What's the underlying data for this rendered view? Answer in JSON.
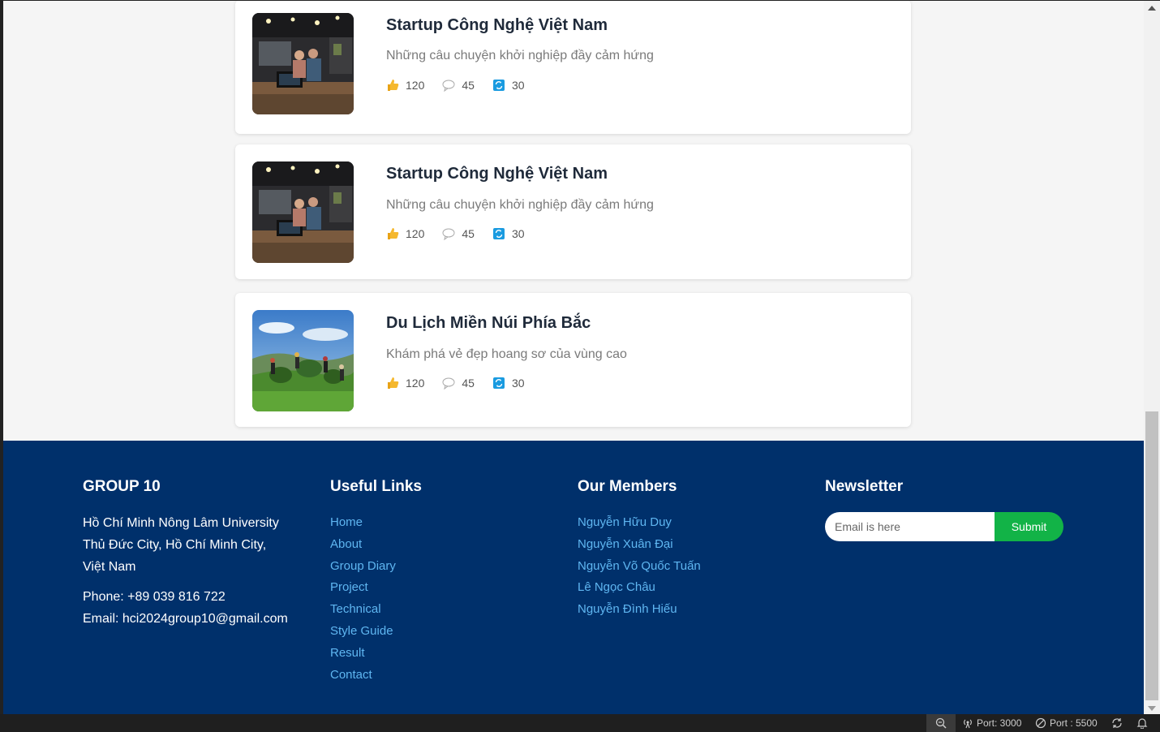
{
  "posts": [
    {
      "title": "Startup Công Nghệ Việt Nam",
      "desc": "Những câu chuyện khởi nghiệp đầy cảm hứng",
      "likes": "120",
      "comments": "45",
      "shares": "30",
      "image": "office-photo"
    },
    {
      "title": "Startup Công Nghệ Việt Nam",
      "desc": "Những câu chuyện khởi nghiệp đầy cảm hứng",
      "likes": "120",
      "comments": "45",
      "shares": "30",
      "image": "office-photo"
    },
    {
      "title": "Du Lịch Miền Núi Phía Bắc",
      "desc": "Khám phá vẻ đẹp hoang sơ của vùng cao",
      "likes": "120",
      "comments": "45",
      "shares": "30",
      "image": "tea-hill-photo"
    }
  ],
  "footer": {
    "group": {
      "heading": "GROUP 10",
      "address": [
        "Hồ Chí Minh Nông Lâm University",
        "Thủ Đức City, Hồ Chí Minh City,",
        "Việt Nam"
      ],
      "phone": "Phone: +89 039 816 722",
      "email": "Email: hci2024group10@gmail.com"
    },
    "links": {
      "heading": "Useful Links",
      "items": [
        "Home",
        "About",
        "Group Diary",
        "Project",
        "Technical",
        "Style Guide",
        "Result",
        "Contact"
      ]
    },
    "members": {
      "heading": "Our Members",
      "items": [
        "Nguyễn Hữu Duy",
        "Nguyễn Xuân Đại",
        "Nguyễn Võ Quốc Tuấn",
        "Lê Ngọc Châu",
        "Nguyễn Đình Hiếu"
      ]
    },
    "newsletter": {
      "heading": "Newsletter",
      "placeholder": "Email is here",
      "submit": "Submit"
    }
  },
  "statusbar": {
    "port1": "Port: 3000",
    "port2": "Port : 5500"
  },
  "colors": {
    "footer_bg": "#00306b",
    "link": "#5fb6f1",
    "submit": "#12b347"
  }
}
